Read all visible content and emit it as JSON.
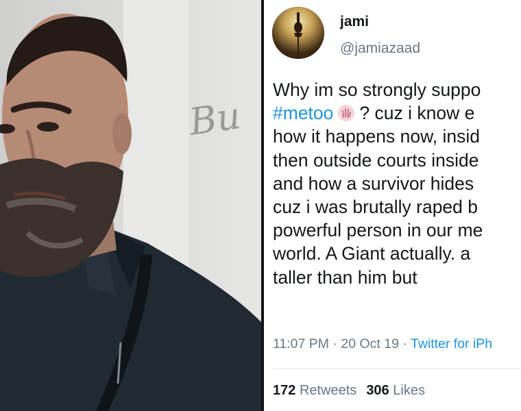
{
  "tweet": {
    "display_name": "jami",
    "handle": "@jamiazaad",
    "text_lines": [
      {
        "before": "Why im so strongly suppo",
        "hashtag": "",
        "after": ""
      },
      {
        "before": "",
        "hashtag": "#metoo",
        "after": "? cuz i know e"
      },
      {
        "before": "how it happens now, insid",
        "hashtag": "",
        "after": ""
      },
      {
        "before": "then outside courts inside",
        "hashtag": "",
        "after": ""
      },
      {
        "before": "and how a survivor hides",
        "hashtag": "",
        "after": ""
      },
      {
        "before": "cuz i was brutally raped b",
        "hashtag": "",
        "after": ""
      },
      {
        "before": "powerful person in our me",
        "hashtag": "",
        "after": ""
      },
      {
        "before": "world. A Giant actually. a",
        "hashtag": "",
        "after": ""
      },
      {
        "before": "taller than him but",
        "hashtag": "",
        "after": ""
      }
    ],
    "time": "11:07 PM",
    "date": "20 Oct 19",
    "separator": "·",
    "source": "Twitter for iPh",
    "retweets_count": "172",
    "retweets_label": "Retweets",
    "likes_count": "306",
    "likes_label": "Likes",
    "colors": {
      "link": "#1b95e0",
      "text": "#14171a",
      "muted": "#657786"
    }
  },
  "photo": {
    "backdrop_text": "Bu"
  }
}
